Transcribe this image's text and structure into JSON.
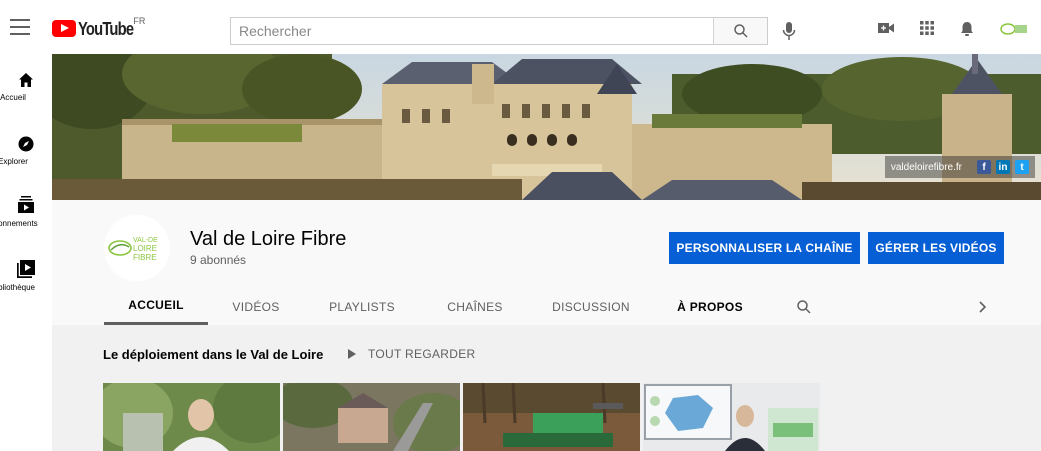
{
  "header": {
    "logo_text": "YouTube",
    "country_code": "FR",
    "search_placeholder": "Rechercher",
    "icons": [
      "menu-icon",
      "search-icon",
      "microphone-icon",
      "create-video-icon",
      "apps-icon",
      "notifications-icon",
      "account-icon"
    ]
  },
  "sidebar": {
    "items": [
      {
        "label": "Accueil",
        "icon": "home-icon"
      },
      {
        "label": "Explorer",
        "icon": "compass-icon"
      },
      {
        "label": "Abonnements",
        "icon": "subscriptions-icon"
      },
      {
        "label": "Bibliothèque",
        "icon": "library-icon"
      }
    ]
  },
  "banner": {
    "url_text": "valdeloirefibre.fr",
    "social": [
      "f",
      "in",
      "t"
    ]
  },
  "channel": {
    "logo_lines": [
      "VAL-DE",
      "LOIRE",
      "FIBRE"
    ],
    "name": "Val de Loire Fibre",
    "subscribers": "9 abonnés",
    "customize_button": "PERSONNALISER LA CHAÎNE",
    "manage_button": "GÉRER LES VIDÉOS"
  },
  "tabs": [
    {
      "label": "ACCUEIL",
      "active": true
    },
    {
      "label": "VIDÉOS"
    },
    {
      "label": "PLAYLISTS"
    },
    {
      "label": "CHAÎNES"
    },
    {
      "label": "DISCUSSION"
    },
    {
      "label": "À PROPOS"
    }
  ],
  "shelf": {
    "title": "Le déploiement dans le Val de Loire",
    "play_all": "TOUT REGARDER"
  },
  "colors": {
    "accent_blue": "#065fd4",
    "youtube_red": "#ff0000",
    "facebook": "#3b5998",
    "linkedin": "#0077b5",
    "twitter": "#1da1f2"
  }
}
